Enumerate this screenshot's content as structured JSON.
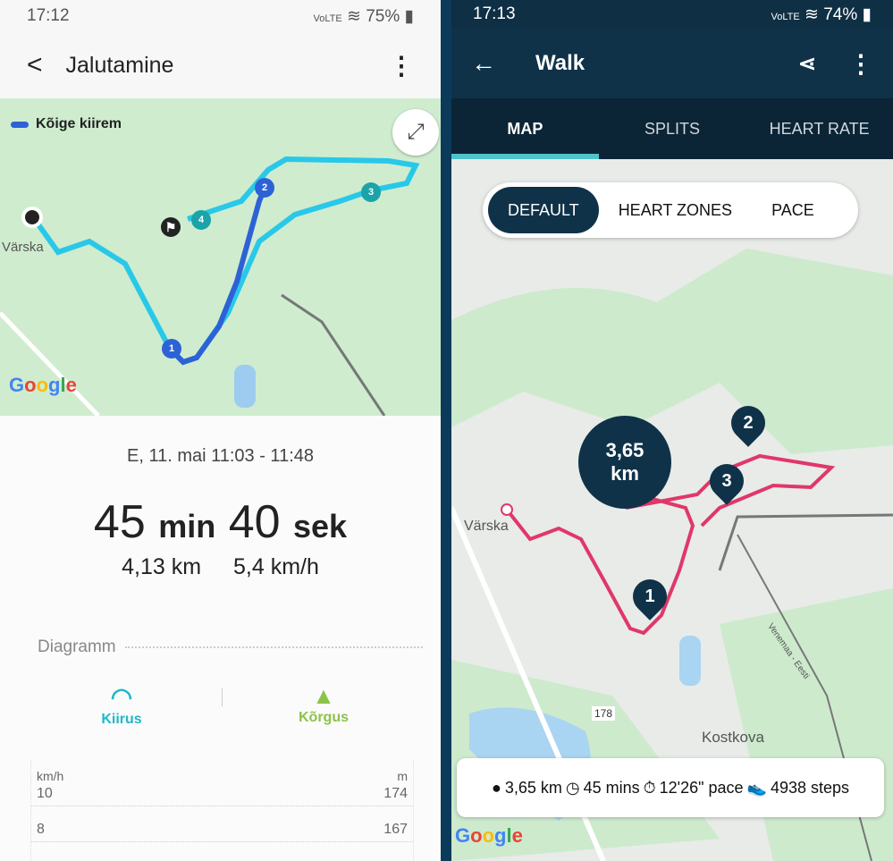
{
  "left": {
    "status": {
      "time": "17:12",
      "network": "VoLTE",
      "battery": "75%"
    },
    "header": {
      "title": "Jalutamine"
    },
    "map": {
      "legend": "Kõige kiirem",
      "town": "Värska",
      "markers": [
        "1",
        "2",
        "3",
        "4"
      ],
      "route_color": "#29c8e8",
      "fastest_color": "#2d62d6"
    },
    "summary": {
      "date": "E, 11. mai 11:03 - 11:48",
      "min_value": "45",
      "min_unit": "min",
      "sec_value": "40",
      "sec_unit": "sek",
      "distance": "4,13 km",
      "speed": "5,4 km/h"
    },
    "diagram": {
      "title": "Diagramm",
      "speed_label": "Kiirus",
      "altitude_label": "Kõrgus",
      "left_unit": "km/h",
      "right_unit": "m",
      "rows": [
        {
          "left": "10",
          "right": "174"
        },
        {
          "left": "8",
          "right": "167"
        }
      ]
    }
  },
  "right": {
    "status": {
      "time": "17:13",
      "network": "VoLTE",
      "battery": "74%"
    },
    "header": {
      "title": "Walk"
    },
    "tabs": [
      {
        "label": "MAP",
        "active": true
      },
      {
        "label": "SPLITS"
      },
      {
        "label": "HEART RATE"
      }
    ],
    "segments": [
      {
        "label": "DEFAULT",
        "active": true
      },
      {
        "label": "HEART ZONES"
      },
      {
        "label": "PACE"
      }
    ],
    "map": {
      "distance_bubble_value": "3,65",
      "distance_bubble_unit": "km",
      "markers": [
        "1",
        "2",
        "3"
      ],
      "labels": {
        "town": "Värska",
        "border": "Venemaa - Eesti",
        "road": "178",
        "village": "Kostkova"
      },
      "route_color": "#e0376a"
    },
    "stats": {
      "distance": "3,65 km",
      "duration": "45 mins",
      "pace": "12'26\" pace",
      "steps": "4938 steps"
    }
  }
}
